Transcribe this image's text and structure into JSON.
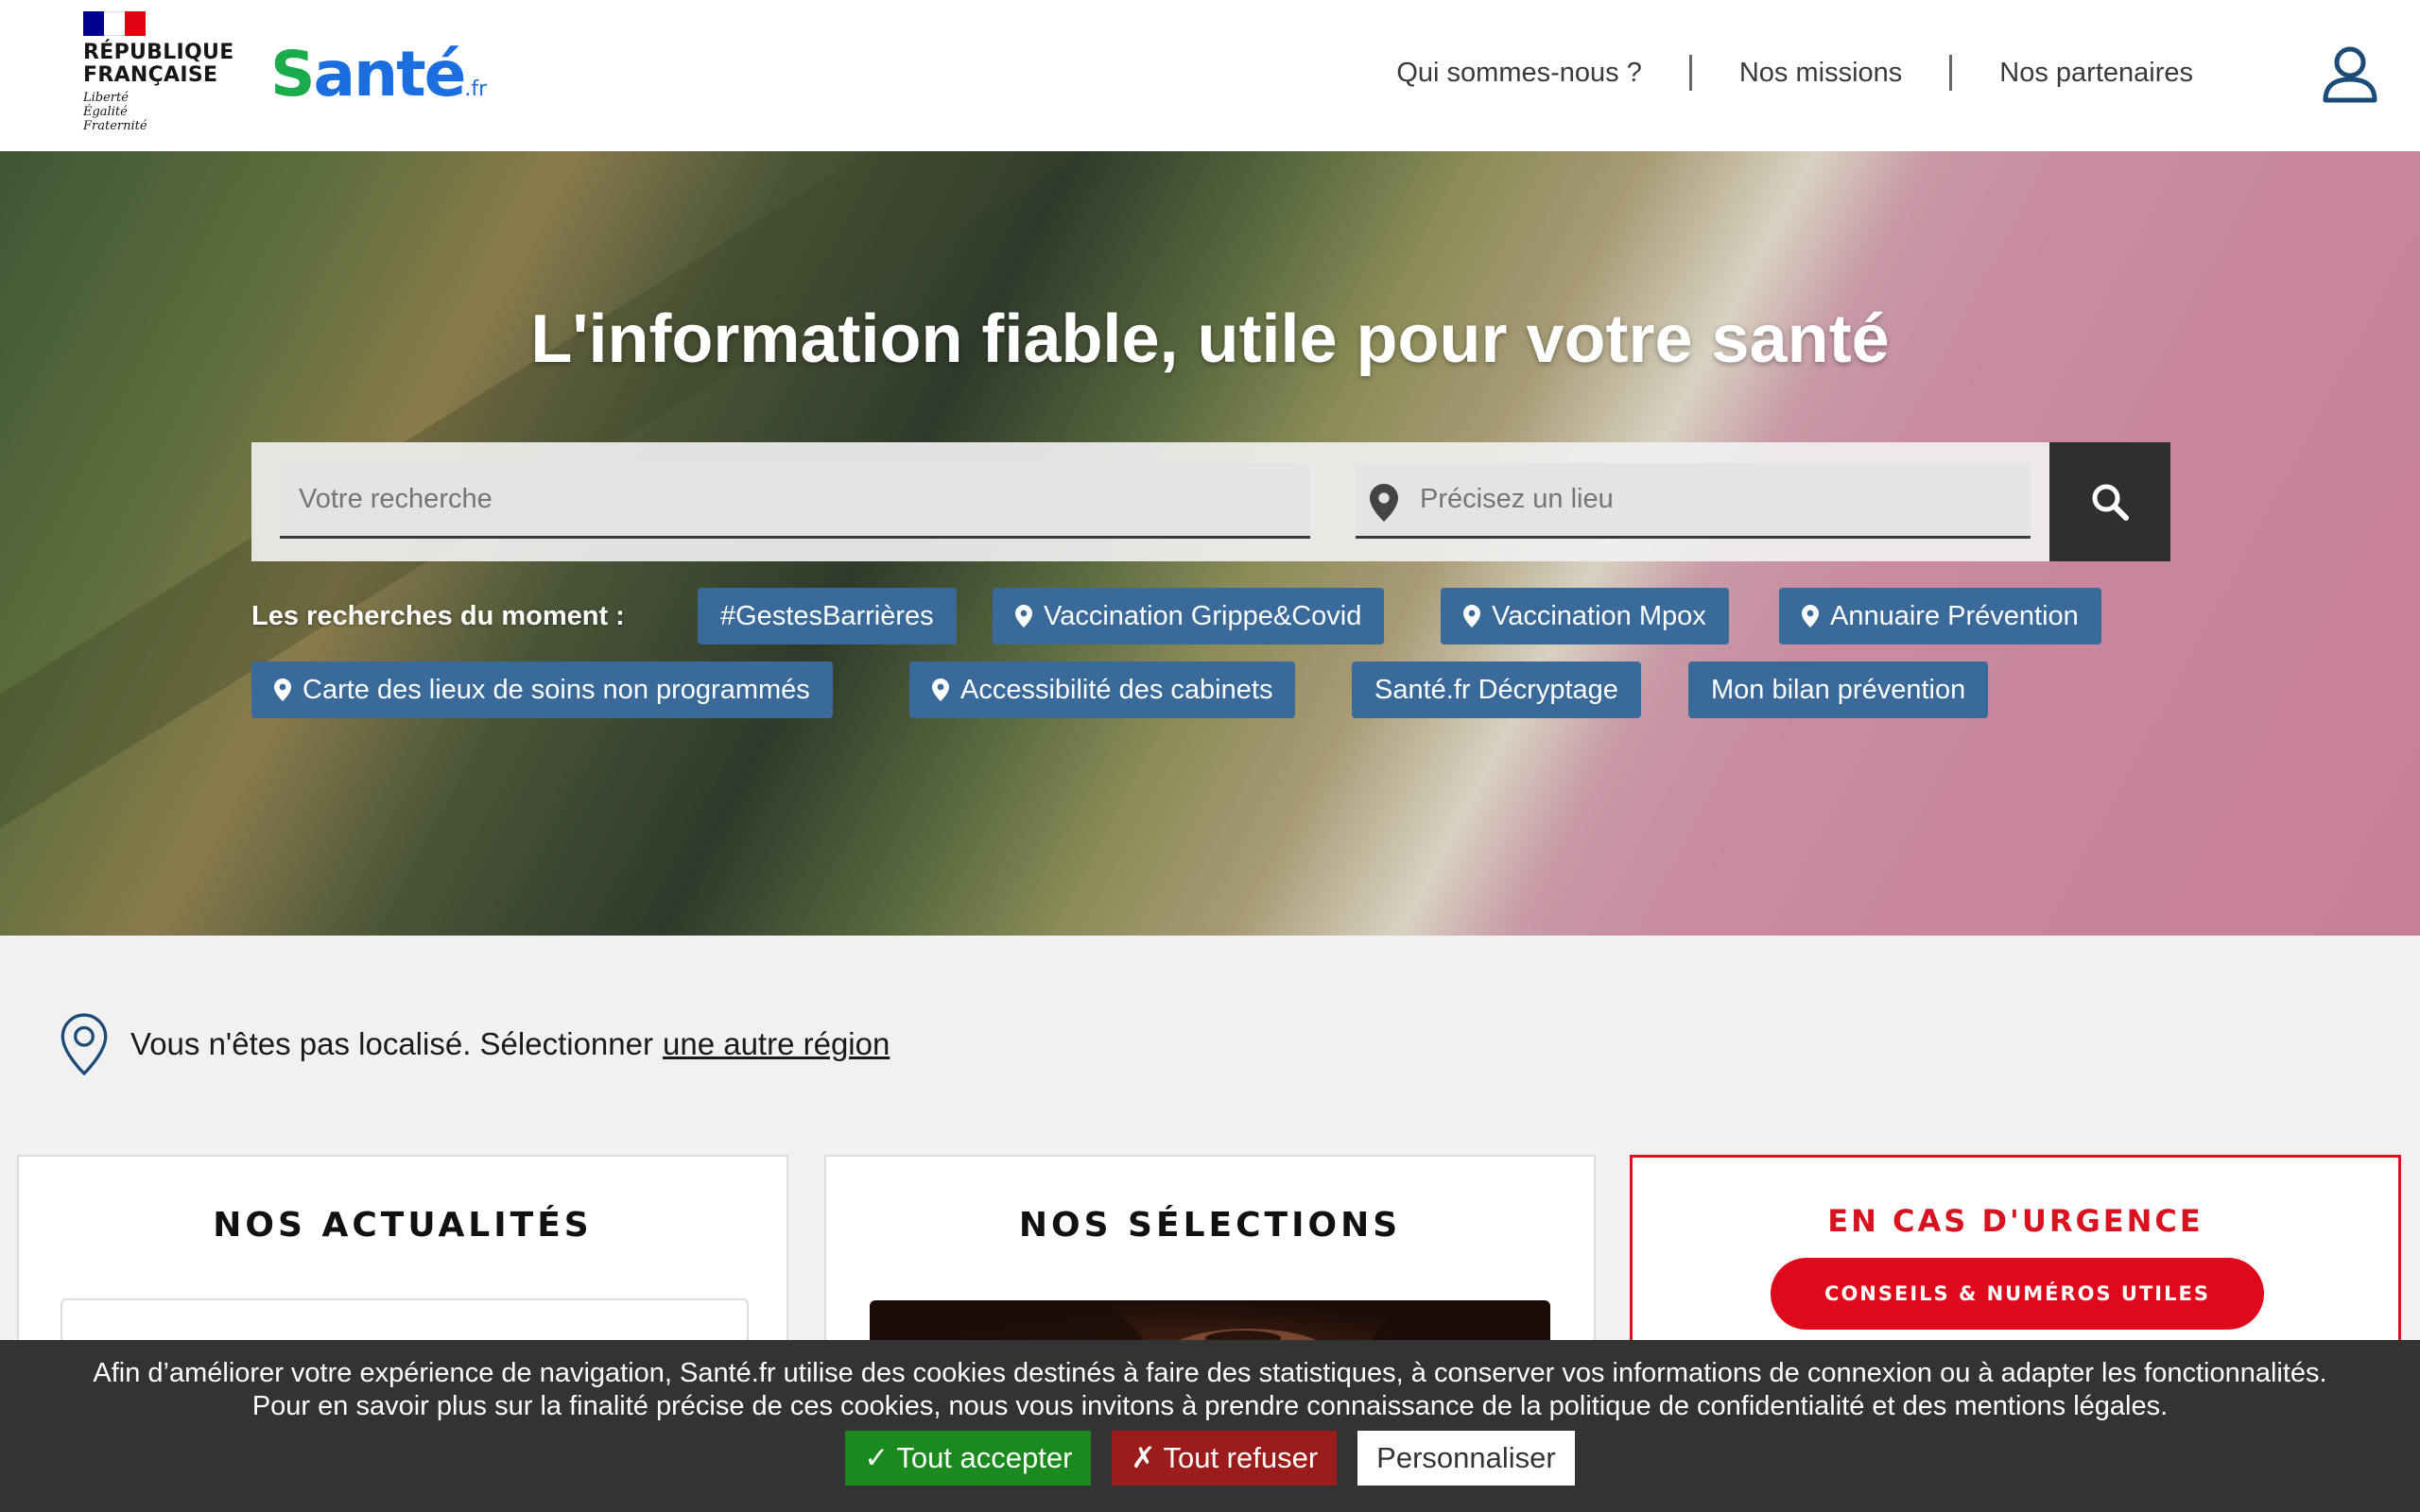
{
  "header": {
    "gov_line1": "RÉPUBLIQUE",
    "gov_line2": "FRANÇAISE",
    "devise": [
      "Liberté",
      "Égalité",
      "Fraternité"
    ],
    "logo_text": "anté",
    "logo_s": "S",
    "logo_fr": ".fr",
    "nav": [
      "Qui sommes-nous ?",
      "Nos missions",
      "Nos partenaires"
    ],
    "user_icon": "user-icon"
  },
  "hero": {
    "title": "L'information fiable, utile pour votre santé",
    "search_placeholder": "Votre recherche",
    "location_placeholder": "Précisez un lieu",
    "search_icon": "search-icon",
    "trending_label": "Les recherches du moment :",
    "tags": [
      {
        "label": "#GestesBarrières",
        "pin": false
      },
      {
        "label": "Vaccination Grippe&Covid",
        "pin": true
      },
      {
        "label": "Vaccination Mpox",
        "pin": true
      },
      {
        "label": "Annuaire Prévention",
        "pin": true
      },
      {
        "label": "Carte des lieux de soins non programmés",
        "pin": true
      },
      {
        "label": "Accessibilité des cabinets",
        "pin": true
      },
      {
        "label": "Santé.fr Décryptage",
        "pin": false
      },
      {
        "label": "Mon bilan prévention",
        "pin": false
      }
    ]
  },
  "location": {
    "text": "Vous n'êtes pas localisé.  Sélectionner",
    "link": "une autre région"
  },
  "cards": {
    "news_title": "NOS ACTUALITÉS",
    "selections_title": "NOS SÉLECTIONS",
    "urgent_title": "EN CAS D'URGENCE",
    "urgent_button": "CONSEILS & NUMÉROS UTILES"
  },
  "cookie": {
    "line1": "Afin d’améliorer votre expérience de navigation, Santé.fr utilise des cookies destinés à faire des statistiques, à conserver vos informations de connexion ou à adapter les fonctionnalités.",
    "line2": "Pour en savoir plus sur la finalité précise de ces cookies, nous vous invitons à prendre connaissance de la politique de confidentialité et des mentions légales.",
    "accept": "✓ Tout accepter",
    "refuse": "✗ Tout refuser",
    "customize": "Personnaliser"
  },
  "colors": {
    "tag_blue": "#3a6a9a",
    "urgent_red": "#e0081b",
    "logo_blue": "#1a6ee0",
    "logo_green": "#1aab4c",
    "accept_green": "#1b8a1e",
    "refuse_red": "#9c1c1c"
  }
}
